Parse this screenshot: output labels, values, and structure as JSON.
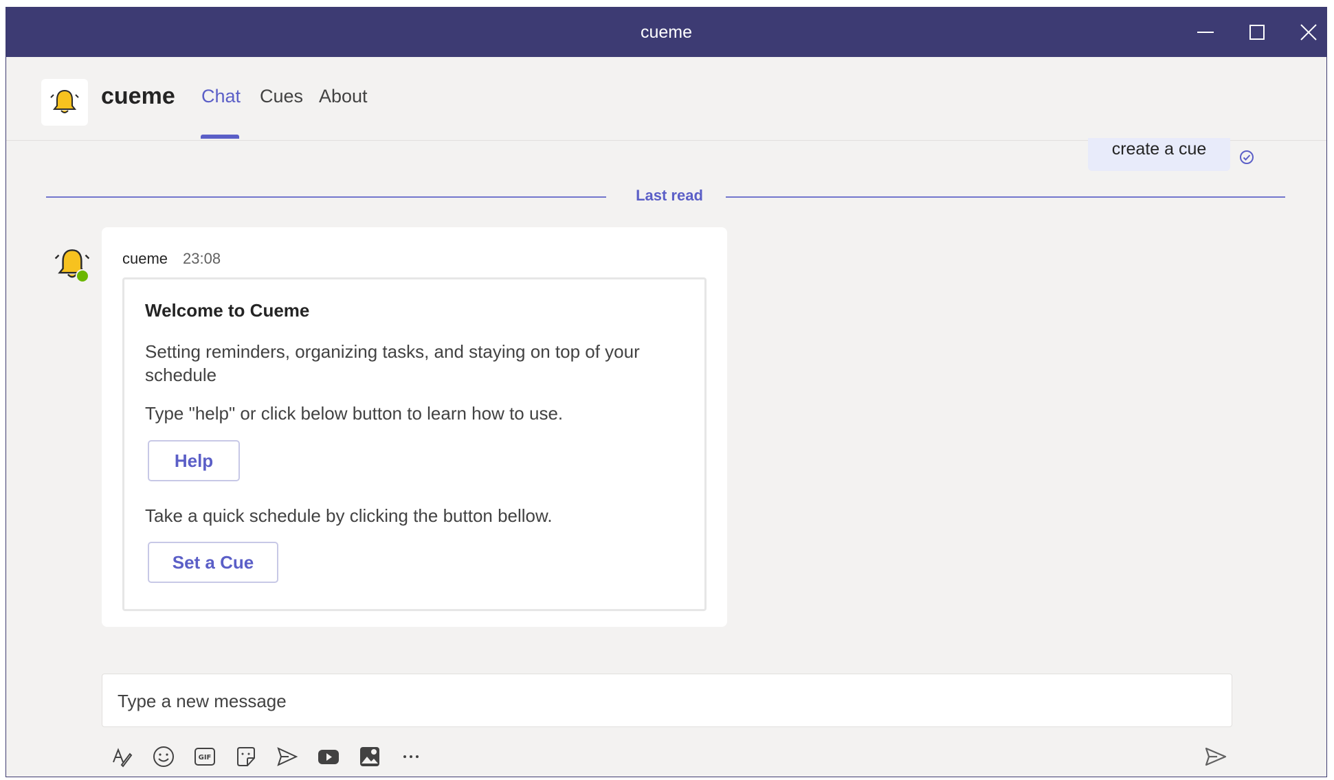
{
  "window": {
    "title": "cueme"
  },
  "header": {
    "app_name": "cueme",
    "tabs": [
      {
        "label": "Chat",
        "active": true
      },
      {
        "label": "Cues",
        "active": false
      },
      {
        "label": "About",
        "active": false
      }
    ]
  },
  "chat": {
    "sent_message": "create a cue",
    "last_read_label": "Last read",
    "message": {
      "sender": "cueme",
      "time": "23:08",
      "card": {
        "title": "Welcome to Cueme",
        "text1": "Setting reminders, organizing tasks, and staying on top of your schedule",
        "text2": "Type \"help\" or click below button to learn how to use.",
        "button1": "Help",
        "text3": "Take a quick schedule by clicking the button bellow.",
        "button2": "Set a Cue"
      }
    }
  },
  "compose": {
    "placeholder": "Type a new message"
  },
  "colors": {
    "titlebar": "#3d3b73",
    "accent": "#5b5fc7",
    "background": "#f3f2f1",
    "bell": "#f7c21f",
    "presence": "#6bb700"
  }
}
